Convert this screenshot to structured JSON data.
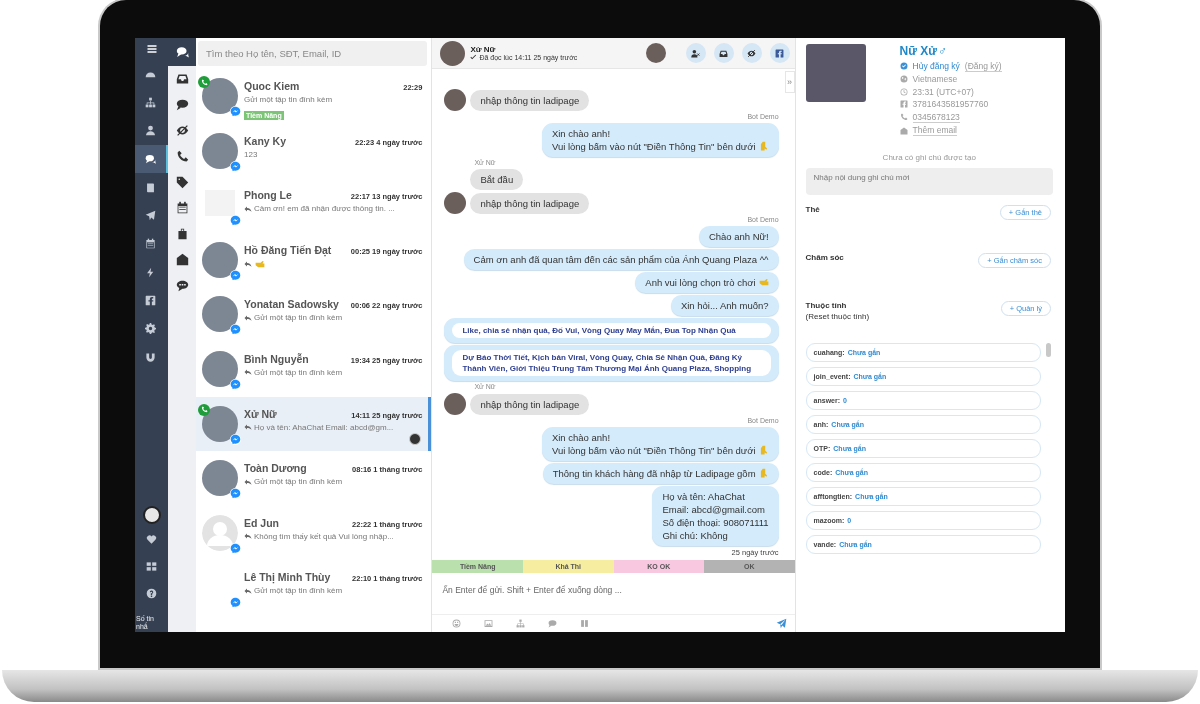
{
  "main_nav": [
    {
      "selected": false
    },
    {
      "selected": false
    },
    {
      "selected": false
    },
    {
      "selected": true
    },
    {
      "selected": false
    },
    {
      "selected": false
    },
    {
      "selected": false
    },
    {
      "selected": false
    },
    {
      "selected": false
    },
    {
      "selected": false
    },
    {
      "selected": false
    }
  ],
  "footer_text": "Số tin nhắ",
  "sub_nav": [
    {
      "selected": true
    },
    {
      "selected": false
    },
    {
      "selected": false
    },
    {
      "selected": false
    },
    {
      "selected": false
    },
    {
      "selected": false
    },
    {
      "selected": false
    },
    {
      "selected": false
    },
    {
      "selected": false
    },
    {
      "selected": false
    }
  ],
  "search": {
    "placeholder": "Tìm theo Họ tên, SĐT, Email, ID"
  },
  "conversations": [
    {
      "name": "Quoc Kiem",
      "time": "22:29",
      "preview": "Gửi một tập tin đính kèm",
      "replied": false,
      "kind": "photo",
      "phone": true,
      "tags": [
        {
          "label": "Tiềm Năng",
          "color": "#7cc576"
        }
      ],
      "selected": false,
      "assigned": false
    },
    {
      "name": "Kany Ky",
      "time": "22:23 4 ngày trước",
      "preview": "123",
      "replied": false,
      "kind": "photo",
      "phone": false,
      "selected": false,
      "assigned": false
    },
    {
      "name": "Phong Le",
      "time": "22:17 13 ngày trước",
      "preview": "Cảm ơn! em đã nhận được thông tin. ...",
      "replied": true,
      "kind": "logo",
      "phone": false,
      "selected": false,
      "assigned": false
    },
    {
      "name": "Hồ Đăng Tiến Đạt",
      "time": "00:25 19 ngày trước",
      "sticker": true,
      "replied": true,
      "kind": "photo",
      "phone": false,
      "selected": false,
      "assigned": false
    },
    {
      "name": "Yonatan Sadowsky",
      "time": "00:06 22 ngày trước",
      "preview": "Gửi một tập tin đính kèm",
      "replied": true,
      "kind": "photo",
      "phone": false,
      "selected": false,
      "assigned": false
    },
    {
      "name": "Bình Nguyễn",
      "time": "19:34 25 ngày trước",
      "preview": "Gửi một tập tin đính kèm",
      "replied": true,
      "kind": "photo",
      "phone": false,
      "selected": false,
      "assigned": false
    },
    {
      "name": "Xử Nữ",
      "time": "14:11 25 ngày trước",
      "preview": "Họ và tên: AhaChat Email: abcd@gm...",
      "replied": true,
      "kind": "photo",
      "phone": true,
      "selected": true,
      "assigned": true
    },
    {
      "name": "Toàn Dương",
      "time": "08:16 1 tháng trước",
      "preview": "Gửi một tập tin đính kèm",
      "replied": true,
      "kind": "photo",
      "phone": false,
      "selected": false,
      "assigned": false
    },
    {
      "name": "Ed Jun",
      "time": "22:22 1 tháng trước",
      "preview": "Không tìm thấy kết quả Vui lòng nhập...",
      "replied": true,
      "kind": "silhouette",
      "phone": false,
      "selected": false,
      "assigned": false
    },
    {
      "name": "Lê Thị Minh Thùy",
      "time": "22:10 1 tháng trước",
      "preview": "Gửi một tập tin đính kèm",
      "replied": true,
      "kind": "none",
      "phone": false,
      "selected": false,
      "assigned": false
    }
  ],
  "chat": {
    "header": {
      "name": "Xử Nữ",
      "status": "Đã đọc lúc 14:11 25 ngày trước"
    },
    "collapse": "»",
    "messages": [
      {
        "kind": "in",
        "avatar": true,
        "text": "nhập thông tin ladipage"
      },
      {
        "kind": "label_out",
        "text": "Bot Demo"
      },
      {
        "kind": "out",
        "text": "Xin chào anh!\nVui lòng bấm vào nút \"Điền Thông Tin\" bên dưới",
        "hand_down": true,
        "hand_right": false
      },
      {
        "kind": "label_in",
        "text": "Xử Nữ"
      },
      {
        "kind": "in",
        "avatar": false,
        "text": "Bắt đầu"
      },
      {
        "kind": "in",
        "avatar": true,
        "text": "nhập thông tin ladipage"
      },
      {
        "kind": "label_out",
        "text": "Bot Demo"
      },
      {
        "kind": "out",
        "text": "Chào anh Nữ!",
        "hand_down": false,
        "hand_right": false
      },
      {
        "kind": "out",
        "text": "Cảm ơn anh đã quan tâm đến các sản phẩm của Ánh Quang Plaza ^^",
        "hand_down": false,
        "hand_right": false
      },
      {
        "kind": "out",
        "text": "Anh vui lòng chọn trò chơi",
        "hand_down": false,
        "hand_right": true
      },
      {
        "kind": "out",
        "text": "Xin hỏi... Anh muốn?",
        "hand_down": false,
        "hand_right": false
      },
      {
        "kind": "buttons",
        "text": "Like, chia sẻ nhận quà, Đố Vui, Vòng Quay May Mắn, Đua Top Nhận Quà"
      },
      {
        "kind": "buttons",
        "text": "Dự Báo Thời Tiết, Kịch bản Viral, Vòng Quay, Chia Sẻ Nhận Quà, Đăng Ký Thành Viên, Giới Thiệu Trung Tâm Thương Mại Ánh Quang Plaza, Shopping"
      },
      {
        "kind": "label_in",
        "text": "Xử Nữ"
      },
      {
        "kind": "in",
        "avatar": true,
        "text": "nhập thông tin ladipage"
      },
      {
        "kind": "label_out",
        "text": "Bot Demo"
      },
      {
        "kind": "out",
        "text": "Xin chào anh!\nVui lòng bấm vào nút \"Điền Thông Tin\" bên dưới",
        "hand_down": true,
        "hand_right": false
      },
      {
        "kind": "out",
        "text": "Thông tin khách hàng đã nhập từ Ladipage gồm",
        "hand_down": true,
        "hand_right": false
      },
      {
        "kind": "out",
        "text": "Họ và tên: AhaChat\nEmail: abcd@gmail.com\nSố điện thoại: 908071111\nGhi chú: Không",
        "hand_down": false,
        "hand_right": false
      },
      {
        "kind": "time",
        "text": "25 ngày trước"
      }
    ],
    "stages": [
      {
        "label": "Tiềm Năng",
        "color": "#b9e0ad"
      },
      {
        "label": "Khả Thi",
        "color": "#f7eda0"
      },
      {
        "label": "KO OK",
        "color": "#f8c8e0"
      },
      {
        "label": "OK",
        "color": "#b3b3b3"
      }
    ],
    "composer": {
      "placeholder": "Ấn Enter để gửi. Shift + Enter để xuống dòng ..."
    }
  },
  "contact": {
    "name": "Nữ Xử",
    "gender": "♂",
    "unsubscribe": "Hủy đăng ký",
    "subscribe": "(Đăng ký)",
    "language": "Vietnamese",
    "local_time": "23:31 (UTC+07)",
    "facebook_id": "3781643581957760",
    "phone": "0345678123",
    "email_link": "Thêm email",
    "notes_empty": "Chưa có ghi chú được tạo",
    "note_placeholder": "Nhập nội dung ghi chú mới",
    "sections": [
      {
        "title": "Thẻ",
        "action": "+ Gắn thẻ"
      },
      {
        "title": "Chăm sóc",
        "action": "+ Gắn chăm sóc"
      },
      {
        "title": "Thuộc tính",
        "subtitle": "(Reset thuộc tính)",
        "action": "+ Quản lý"
      }
    ],
    "attributes": [
      {
        "key": "cuahang:",
        "value": "Chưa gắn"
      },
      {
        "key": "join_event:",
        "value": "Chưa gắn"
      },
      {
        "key": "answer:",
        "value": "0"
      },
      {
        "key": "anh:",
        "value": "Chưa gắn"
      },
      {
        "key": "OTP:",
        "value": "Chưa gắn"
      },
      {
        "key": "code:",
        "value": "Chưa gắn"
      },
      {
        "key": "afftongtien:",
        "value": "Chưa gắn"
      },
      {
        "key": "mazoom:",
        "value": "0"
      },
      {
        "key": "vande:",
        "value": "Chưa gắn"
      }
    ]
  }
}
